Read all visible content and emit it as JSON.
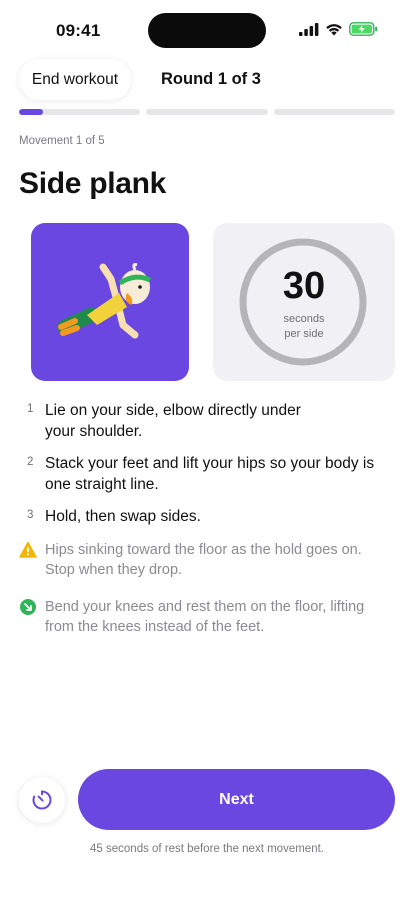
{
  "status_bar": {
    "time": "09:41"
  },
  "header": {
    "end_label": "End workout",
    "round_label": "Round 1 of 3"
  },
  "progress": {
    "segments": 3,
    "current": 1,
    "current_fraction": 0.2
  },
  "movement_label": "Movement 1 of 5",
  "exercise": {
    "title": "Side plank"
  },
  "timer": {
    "value": "30",
    "unit_line1": "seconds",
    "unit_line2": "per side"
  },
  "steps": [
    {
      "num": "1",
      "text_line1": "Lie on your side, elbow directly under",
      "text_line2": "your shoulder."
    },
    {
      "num": "2",
      "text_line1": "Stack your feet and lift your hips so your body is",
      "text_line2": "one straight line."
    },
    {
      "num": "3",
      "text_line1": "Hold, then swap sides.",
      "text_line2": ""
    }
  ],
  "warning": {
    "icon": "warning-icon",
    "line1": "Hips sinking toward the floor as the hold goes on.",
    "line2": "Stop when they drop."
  },
  "tip": {
    "icon": "easier-option-icon",
    "line1": "Bend your knees and rest them on the floor, lifting",
    "line2": "from the knees instead of the feet."
  },
  "footer": {
    "next_label": "Next",
    "rest_note": "45 seconds of rest before the next movement.",
    "timer_icon": "timer-icon"
  },
  "colors": {
    "accent": "#6a47e0",
    "warning": "#f2b705",
    "tip": "#2fb45a",
    "ring": "#b5b5b8"
  }
}
